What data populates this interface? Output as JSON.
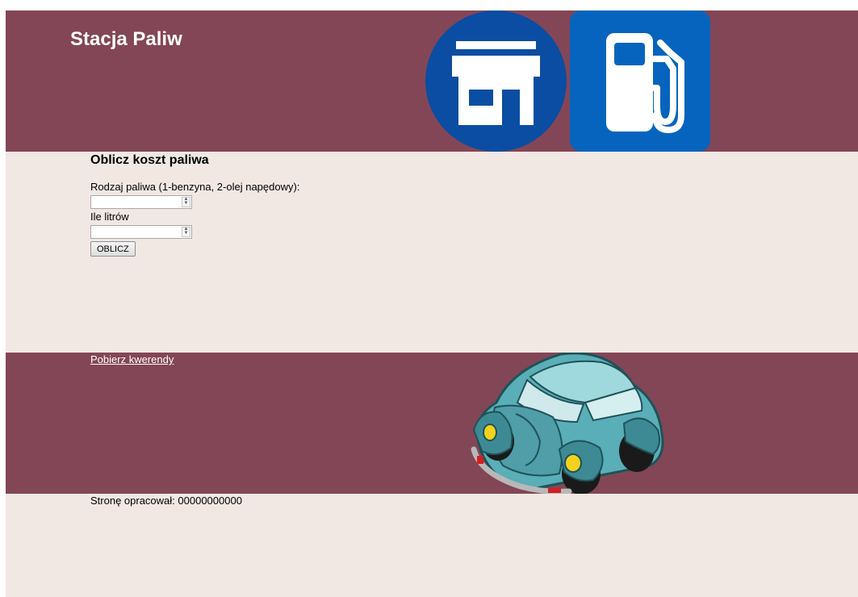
{
  "header": {
    "title": "Stacja Paliw",
    "icons": [
      "shop-icon",
      "fuel-pump-icon"
    ],
    "background_color": "#834656"
  },
  "form": {
    "heading": "Oblicz koszt paliwa",
    "fuel_type_label": "Rodzaj paliwa (1-benzyna, 2-olej napędowy):",
    "fuel_type_value": "",
    "liters_label": "Ile litrów",
    "liters_value": "",
    "submit_label": "OBLICZ"
  },
  "lower_section": {
    "link_text": "Pobierz kwerendy",
    "image": "car-illustration"
  },
  "footer": {
    "text": "Stronę opracował: 00000000000"
  },
  "colors": {
    "banner": "#834656",
    "content_background": "#f1e8e4"
  }
}
